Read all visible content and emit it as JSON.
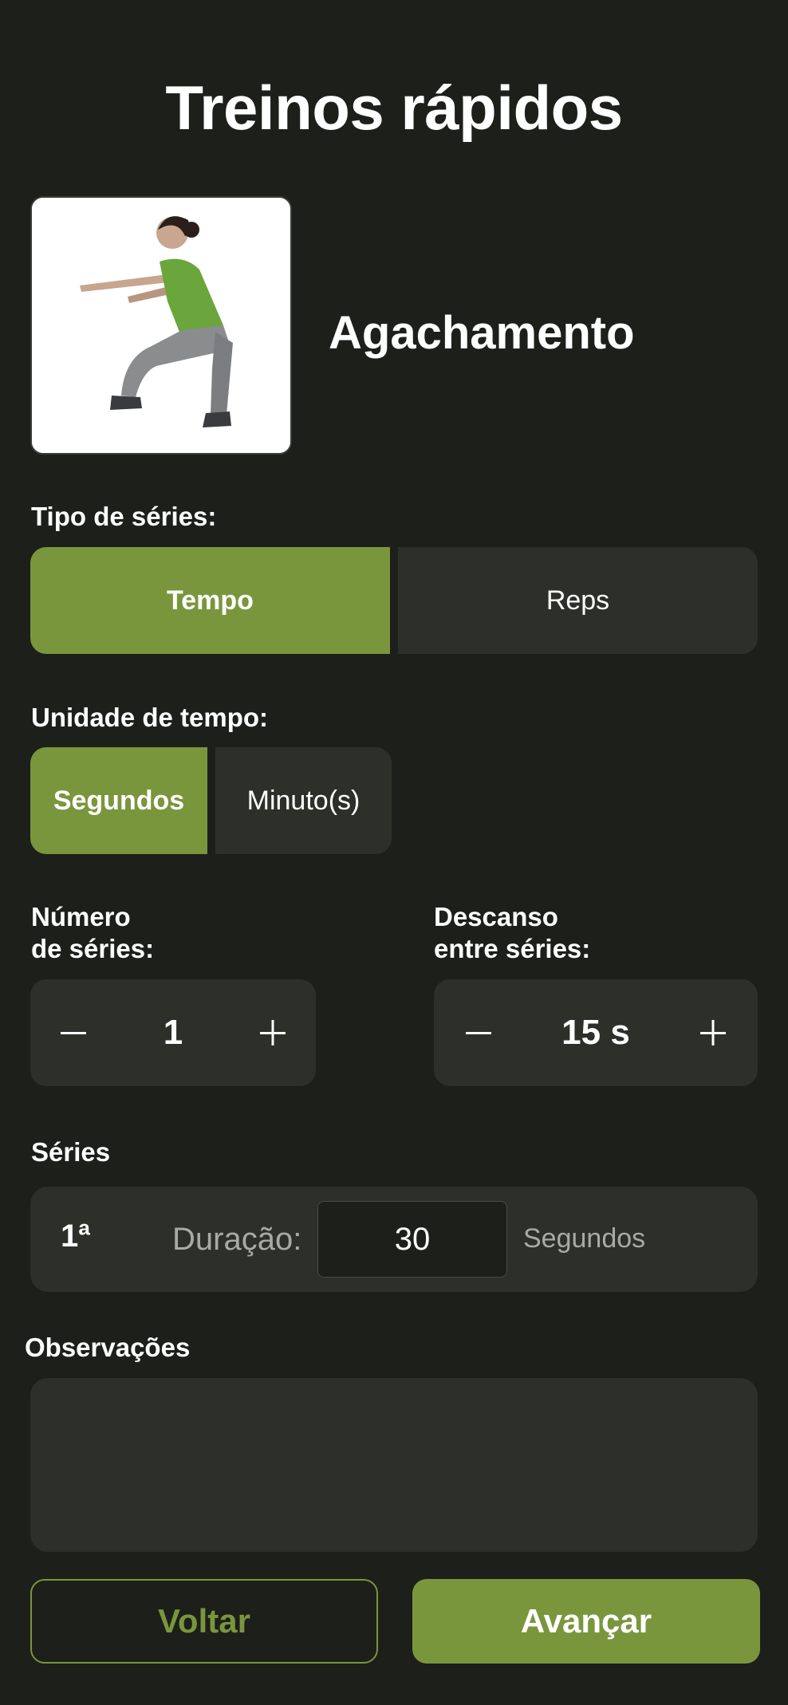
{
  "header": {
    "title": "Treinos rápidos"
  },
  "exercise": {
    "name": "Agachamento",
    "image": "squat-illustration"
  },
  "series_type": {
    "label": "Tipo de séries:",
    "options": [
      "Tempo",
      "Reps"
    ],
    "selected": "Tempo"
  },
  "time_unit": {
    "label": "Unidade de tempo:",
    "options": [
      "Segundos",
      "Minuto(s)"
    ],
    "selected": "Segundos"
  },
  "num_series": {
    "label_line1": "Número",
    "label_line2": "de séries:",
    "value": "1"
  },
  "rest": {
    "label_line1": "Descanso",
    "label_line2": "entre séries:",
    "value": "15 s"
  },
  "series_list": {
    "label": "Séries",
    "rows": [
      {
        "index": "1ª",
        "duration_label": "Duração:",
        "duration_value": "30",
        "unit": "Segundos"
      }
    ]
  },
  "notes": {
    "label": "Observações",
    "value": ""
  },
  "footer": {
    "back_label": "Voltar",
    "next_label": "Avançar"
  },
  "colors": {
    "accent": "#7a963d",
    "background": "#1d1f1a",
    "surface": "#2d2f29"
  },
  "icons": {
    "decrement": "minus-icon",
    "increment": "plus-icon"
  }
}
